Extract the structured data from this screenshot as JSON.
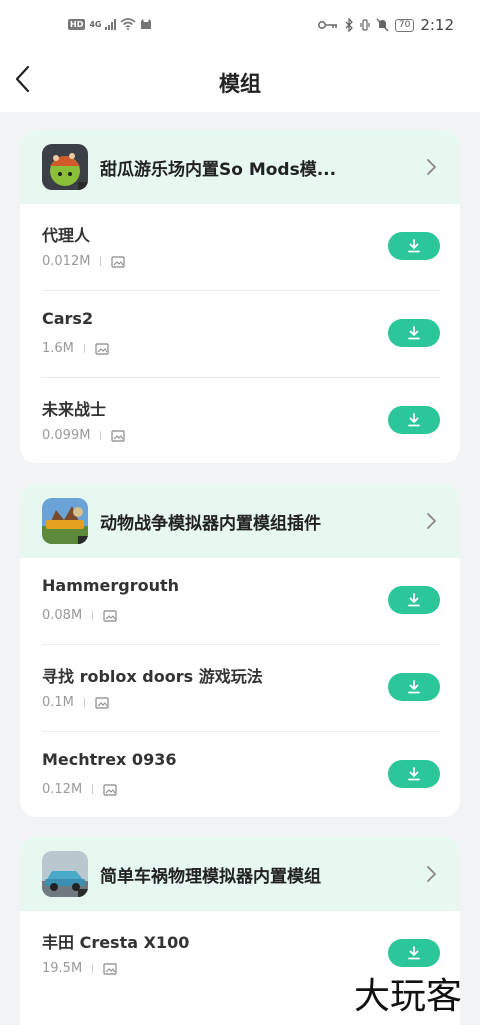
{
  "status_bar": {
    "hd": "HD",
    "network": "4G",
    "battery": "70",
    "time": "2:12"
  },
  "nav": {
    "title": "模组"
  },
  "groups": [
    {
      "title": "甜瓜游乐场内置So Mods模...",
      "icon": "melon-playground-game-icon",
      "mods": [
        {
          "name": "代理人",
          "size": "0.012M"
        },
        {
          "name": "Cars2",
          "size": "1.6M"
        },
        {
          "name": "未来战士",
          "size": "0.099M"
        }
      ]
    },
    {
      "title": "动物战争模拟器内置模组插件",
      "icon": "animal-war-game-icon",
      "mods": [
        {
          "name": "Hammergrouth",
          "size": "0.08M"
        },
        {
          "name": "寻找 roblox doors 游戏玩法",
          "size": "0.1M"
        },
        {
          "name": "Mechtrex 0936",
          "size": "0.12M"
        }
      ]
    },
    {
      "title": "简单车祸物理模拟器内置模组",
      "icon": "car-crash-game-icon",
      "mods": [
        {
          "name": "丰田 Cresta X100",
          "size": "19.5M"
        }
      ]
    }
  ],
  "watermark": "大玩客",
  "colors": {
    "accent": "#2bc69a",
    "header_bg": "#e7f8f1",
    "page_bg": "#f2f3f5"
  }
}
